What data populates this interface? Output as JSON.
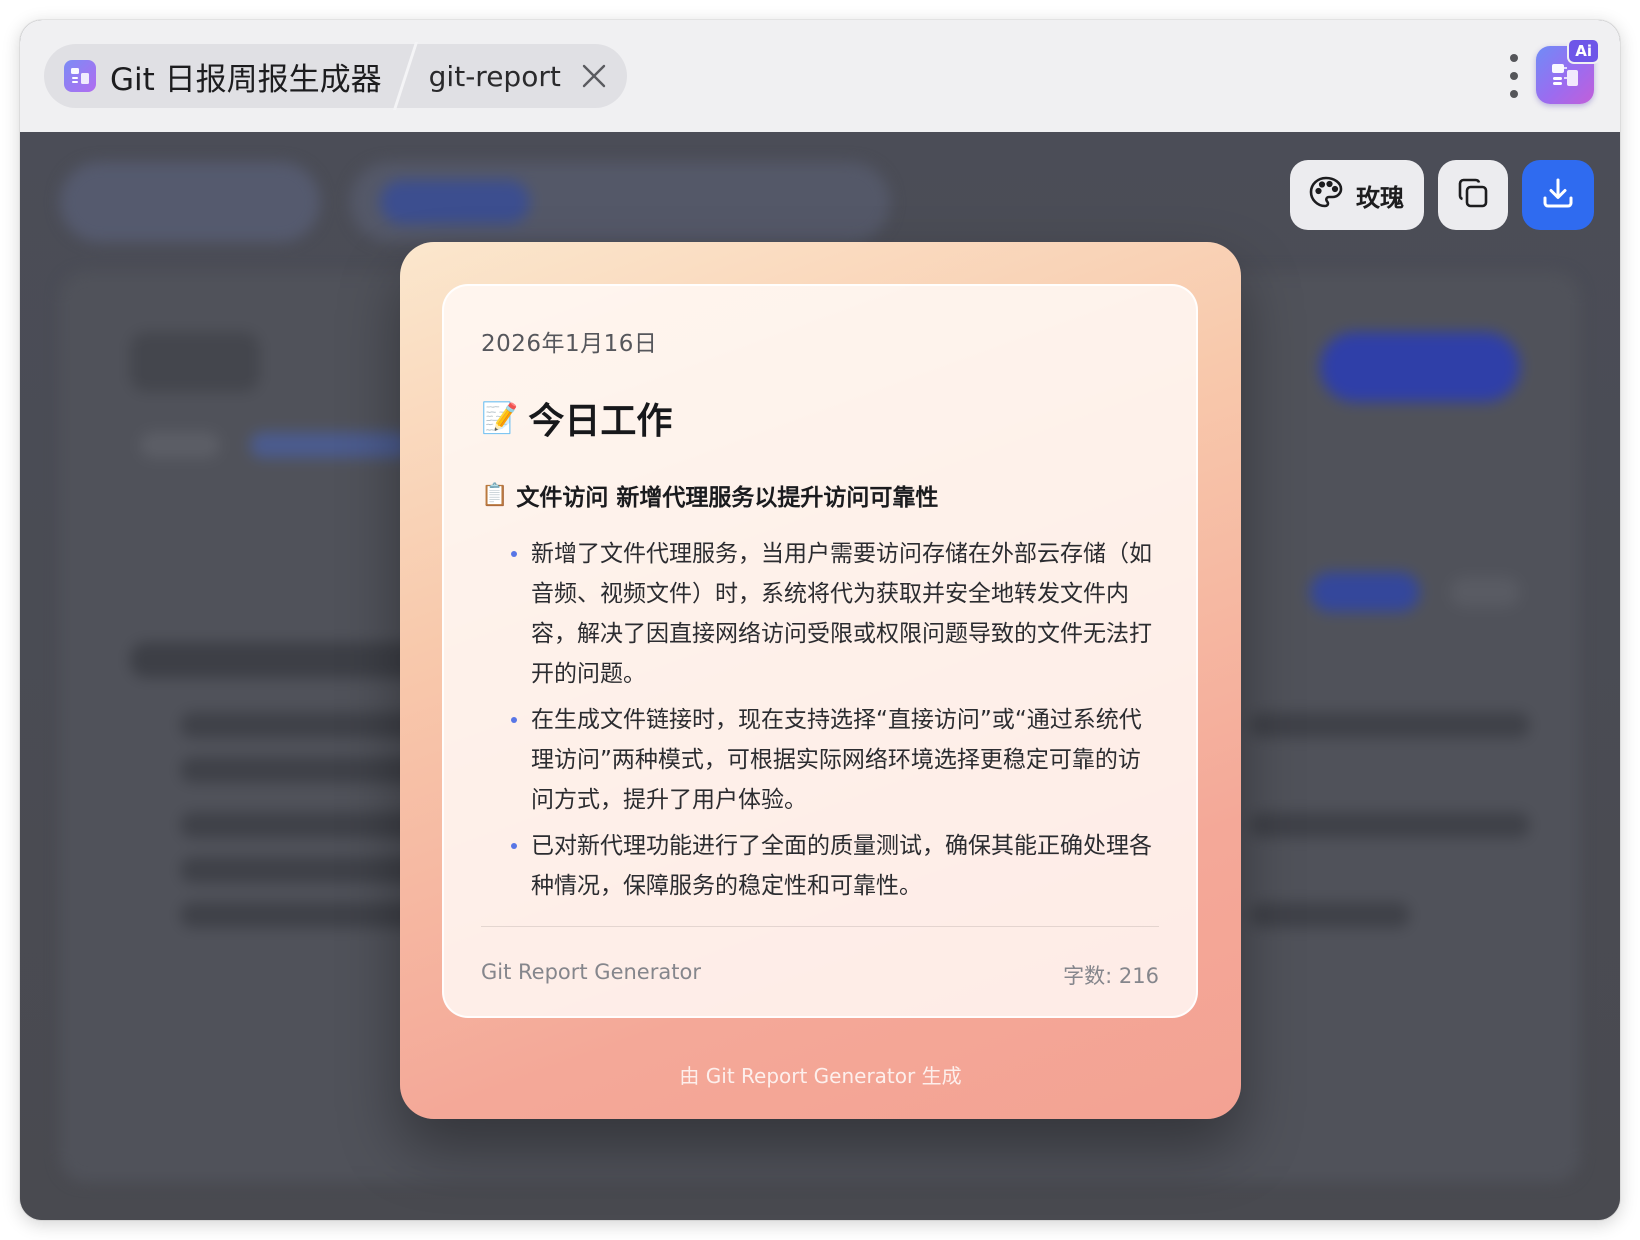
{
  "window": {
    "tab_title": "Git 日报周报生成器",
    "tab_subtitle": "git-report",
    "close_icon": "close-icon",
    "menu_icon": "more-vertical-icon",
    "ai_badge": "Ai",
    "app_icon": "report-app-icon"
  },
  "toolbar": {
    "theme_label": "玫瑰",
    "theme_icon": "palette-icon",
    "copy_icon": "copy-icon",
    "download_icon": "download-icon",
    "accent_color": "#2f6bf0"
  },
  "card": {
    "date": "2026年1月16日",
    "heading_emoji": "📝",
    "heading": "今日工作",
    "section_emoji": "📋",
    "section_title": "文件访问 新增代理服务以提升访问可靠性",
    "bullets": [
      "新增了文件代理服务，当用户需要访问存储在外部云存储（如音频、视频文件）时，系统将代为获取并安全地转发文件内容，解决了因直接网络访问受限或权限问题导致的文件无法打开的问题。",
      "在生成文件链接时，现在支持选择“直接访问”或“通过系统代理访问”两种模式，可根据实际网络环境选择更稳定可靠的访问方式，提升了用户体验。",
      "已对新代理功能进行了全面的质量测试，确保其能正确处理各种情况，保障服务的稳定性和可靠性。"
    ],
    "footer_brand": "Git Report Generator",
    "word_count": "字数: 216",
    "generated_by": "由 Git Report Generator 生成",
    "theme_gradient": [
      "#fbe7cd",
      "#f3a293"
    ]
  }
}
